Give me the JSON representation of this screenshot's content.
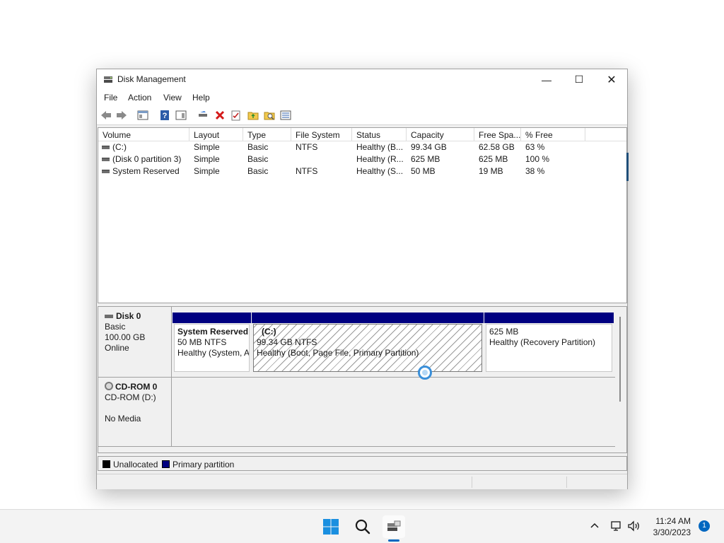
{
  "window": {
    "title": "Disk Management",
    "icon": "disk-management-icon",
    "minimize_glyph": "—",
    "maximize_glyph": "☐",
    "close_glyph": "✕"
  },
  "menu": [
    "File",
    "Action",
    "View",
    "Help"
  ],
  "toolbar": [
    "back-arrow-icon",
    "forward-arrow-icon",
    "console-view-icon",
    "help-icon",
    "action-pane-icon",
    "connect-disk-icon",
    "delete-icon",
    "properties-icon",
    "open-folder-icon",
    "explore-icon",
    "list-view-icon"
  ],
  "volume_list": {
    "columns": [
      "Volume",
      "Layout",
      "Type",
      "File System",
      "Status",
      "Capacity",
      "Free Spa...",
      "% Free"
    ],
    "rows": [
      [
        "(C:)",
        "Simple",
        "Basic",
        "NTFS",
        "Healthy (B...",
        "99.34 GB",
        "62.58 GB",
        "63 %"
      ],
      [
        "(Disk 0 partition 3)",
        "Simple",
        "Basic",
        "",
        "Healthy (R...",
        "625 MB",
        "625 MB",
        "100 %"
      ],
      [
        "System Reserved",
        "Simple",
        "Basic",
        "NTFS",
        "Healthy (S...",
        "50 MB",
        "19 MB",
        "38 %"
      ]
    ]
  },
  "disks": [
    {
      "name": "Disk 0",
      "type": "Basic",
      "size": "100.00 GB",
      "state": "Online",
      "partitions": [
        {
          "title": "System Reserved",
          "line1": "50 MB NTFS",
          "line2": "Healthy (System, A"
        },
        {
          "title": "(C:)",
          "line1": "99.34 GB NTFS",
          "line2": "Healthy (Boot, Page File, Primary Partition)"
        },
        {
          "title": "",
          "line1": "625 MB",
          "line2": "Healthy (Recovery Partition)"
        }
      ]
    },
    {
      "name": "CD-ROM 0",
      "type": "CD-ROM (D:)",
      "state": "No Media"
    }
  ],
  "legend": [
    {
      "label": "Unallocated",
      "color": "#000000"
    },
    {
      "label": "Primary partition",
      "color": "#000080"
    }
  ],
  "taskbar": {
    "time": "11:24 AM",
    "date": "3/30/2023",
    "notification_count": "1",
    "tray_icons": [
      "chevron-up-icon",
      "network-icon",
      "volume-icon"
    ]
  }
}
